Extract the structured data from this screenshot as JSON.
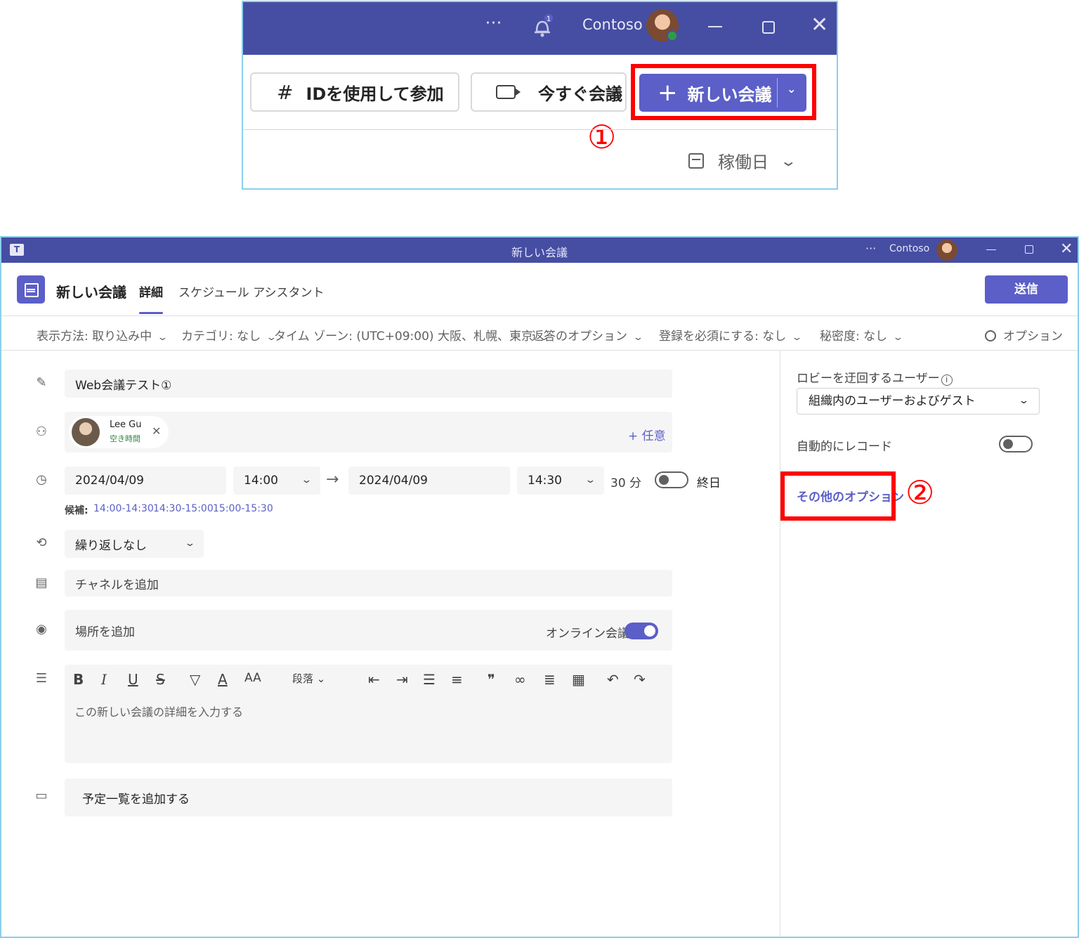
{
  "snippet": {
    "user_name": "Contoso",
    "notification_badge": "1",
    "btn_join": "IDを使用して参加",
    "btn_meet_now": "今すぐ会議",
    "btn_new_meeting": "新しい会議",
    "marker_1": "①",
    "workday_label": "稼働日"
  },
  "window": {
    "title": "新しい会議",
    "user_name": "Contoso",
    "header_title": "新しい会議",
    "tab_details": "詳細",
    "tab_assistant": "スケジュール アシスタント",
    "send_label": "送信"
  },
  "options_bar": {
    "show_as": "表示方法: 取り込み中",
    "category": "カテゴリ: なし",
    "timezone": "タイム ゾーン: (UTC+09:00) 大阪、札幌、東京",
    "response": "返答のオプション",
    "registration": "登録を必須にする: なし",
    "sensitivity": "秘密度: なし",
    "options": "オプション"
  },
  "form": {
    "title_value": "Web会議テスト①",
    "attendee_name": "Lee Gu",
    "attendee_status": "空き時間",
    "optional_label": "+ 任意",
    "start_date": "2024/04/09",
    "start_time": "14:00",
    "end_date": "2024/04/09",
    "end_time": "14:30",
    "duration": "30 分",
    "all_day": "終日",
    "suggestions_label": "候補:",
    "suggestions": [
      "14:00-14:30",
      "14:30-15:00",
      "15:00-15:30"
    ],
    "repeat": "繰り返しなし",
    "channel_placeholder": "チャネルを追加",
    "location_placeholder": "場所を追加",
    "online_meeting_label": "オンライン会議",
    "online_meeting_on": true,
    "paragraph_label": "段落",
    "details_placeholder": "この新しい会議の詳細を入力する",
    "agenda_label": "予定一覧を追加する"
  },
  "right_panel": {
    "lobby_label": "ロビーを迂回するユーザー",
    "lobby_value": "組織内のユーザーおよびゲスト",
    "auto_record_label": "自動的にレコード",
    "auto_record_on": false,
    "more_options": "その他のオプション",
    "marker_2": "②"
  },
  "colors": {
    "titlebar": "#464ea3",
    "accent": "#5b5fc7",
    "highlight": "#ff0000"
  }
}
